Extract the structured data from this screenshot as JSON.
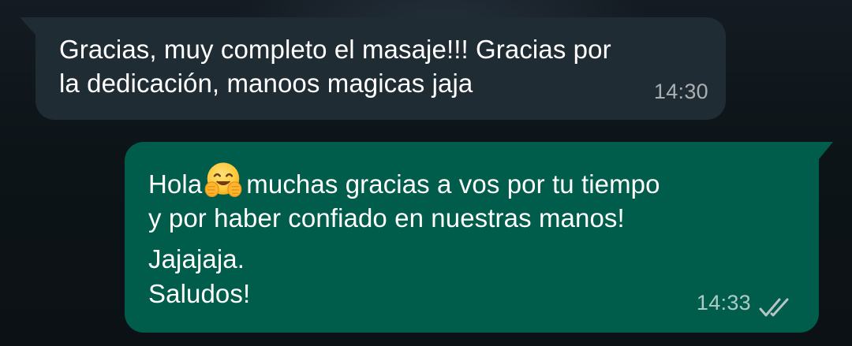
{
  "conversation": {
    "messages": [
      {
        "direction": "incoming",
        "lines": [
          "Gracias, muy completo el masaje!!! Gracias por",
          "la dedicación, manoos magicas jaja"
        ],
        "time": "14:30"
      },
      {
        "direction": "outgoing",
        "first_line_prefix": "Hola",
        "emoji": "hugging-face-icon",
        "first_line_suffix": "muchas gracias a vos por tu tiempo",
        "lines": [
          "y por haber confiado en nuestras manos!",
          "Jajajaja.",
          "Saludos!"
        ],
        "time": "14:33",
        "status": "read-double-check-icon"
      }
    ]
  },
  "colors": {
    "incoming_bubble": "#1f2c34",
    "outgoing_bubble": "#005c4b",
    "background": "#0b1115",
    "timestamp": "#9fb0b5"
  }
}
